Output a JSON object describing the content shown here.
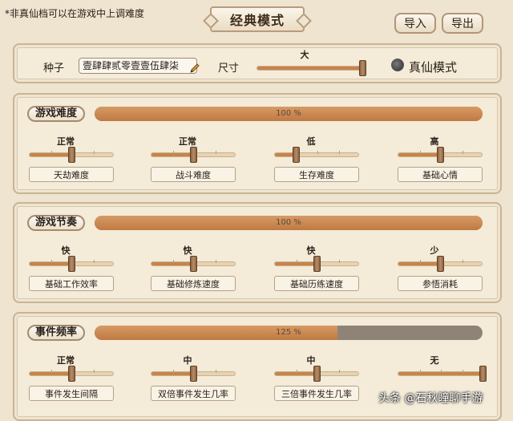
{
  "note": "*非真仙档可以在游戏中上调难度",
  "title": "经典模式",
  "buttons": {
    "import": "导入",
    "export": "导出"
  },
  "seed": {
    "label": "种子",
    "value": "壹肆肆贰零壹壹伍肆柒"
  },
  "size": {
    "label": "尺寸",
    "value_label": "大",
    "level": 1.0
  },
  "true_immortal": {
    "label": "真仙模式",
    "checked": false
  },
  "sections": [
    {
      "title": "游戏难度",
      "percent_text": "100 %",
      "percent": 100,
      "sliders": [
        {
          "value": "正常",
          "caption": "天劫难度",
          "level": 0.5
        },
        {
          "value": "正常",
          "caption": "战斗难度",
          "level": 0.5
        },
        {
          "value": "低",
          "caption": "生存难度",
          "level": 0.25
        },
        {
          "value": "高",
          "caption": "基础心情",
          "level": 0.5
        }
      ]
    },
    {
      "title": "游戏节奏",
      "percent_text": "100 %",
      "percent": 100,
      "sliders": [
        {
          "value": "快",
          "caption": "基础工作效率",
          "level": 0.5
        },
        {
          "value": "快",
          "caption": "基础修炼速度",
          "level": 0.5
        },
        {
          "value": "快",
          "caption": "基础历练速度",
          "level": 0.5
        },
        {
          "value": "少",
          "caption": "参悟消耗",
          "level": 0.5
        }
      ]
    },
    {
      "title": "事件频率",
      "percent_text": "125 %",
      "percent": 62.5,
      "sliders": [
        {
          "value": "正常",
          "caption": "事件发生间隔",
          "level": 0.5
        },
        {
          "value": "中",
          "caption": "双倍事件发生几率",
          "level": 0.5
        },
        {
          "value": "中",
          "caption": "三倍事件发生几率",
          "level": 0.5
        },
        {
          "value": "无",
          "caption": "",
          "level": 1.0
        }
      ]
    }
  ],
  "watermark": "头条 @石秋瞳聊手游"
}
